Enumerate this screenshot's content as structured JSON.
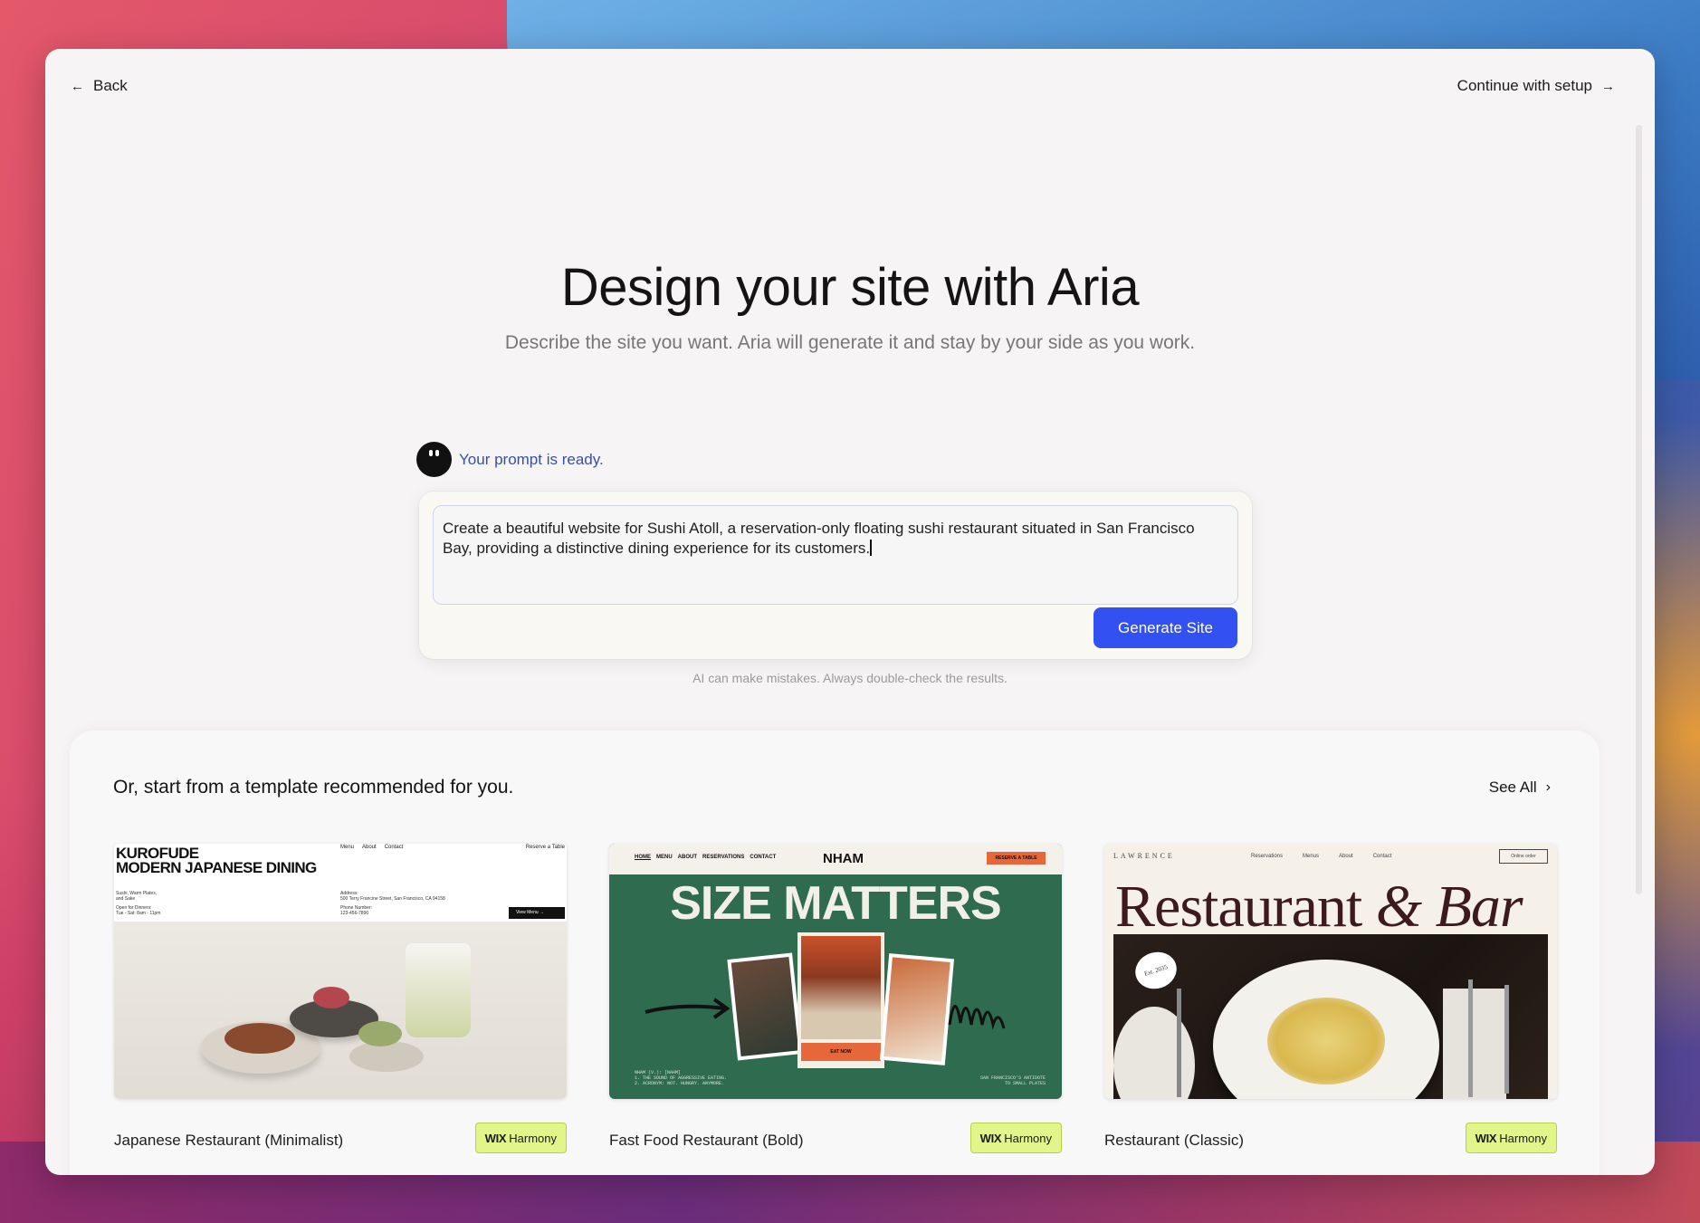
{
  "topbar": {
    "back_label": "Back",
    "continue_label": "Continue with setup"
  },
  "hero": {
    "title": "Design your site with Aria",
    "subtitle": "Describe the site you want. Aria will generate it and stay by your side as you work."
  },
  "prompt": {
    "status_text": "Your prompt is ready.",
    "value": "Create a beautiful website for Sushi Atoll, a reservation-only floating sushi restaurant situated in San Francisco Bay, providing a distinctive dining experience for its customers.",
    "generate_label": "Generate Site",
    "disclaimer": "AI can make mistakes. Always double-check the results."
  },
  "templates": {
    "heading": "Or, start from a template recommended for you.",
    "see_all_label": "See All",
    "items": [
      {
        "name": "Japanese Restaurant (Minimalist)",
        "badge_brand": "WIX",
        "badge_text": "Harmony",
        "thumb": {
          "brand_line1": "KUROFUDE",
          "brand_line2": "MODERN JAPANESE DINING",
          "nav": [
            "Menu",
            "About",
            "Contact"
          ],
          "reserve": "Reserve a Table",
          "info_left_1": "Sushi, Warm Plates,",
          "info_left_2": "and Sake",
          "info_left_3": "Open for Dinners:",
          "info_left_4": "Tue - Sat: 8am - 11pm",
          "address_label": "Address:",
          "address_value": "500 Terry Francine Street, San Francisco, CA 94158",
          "phone_label": "Phone Number:",
          "phone_value": "123-456-7890",
          "menu_button": "View Menu"
        }
      },
      {
        "name": "Fast Food Restaurant (Bold)",
        "badge_brand": "WIX",
        "badge_text": "Harmony",
        "thumb": {
          "nav": [
            "HOME",
            "MENU",
            "ABOUT",
            "RESERVATIONS",
            "CONTACT"
          ],
          "logo": "NHAM",
          "reserve": "RESERVE A TABLE",
          "headline": "SIZE MATTERS",
          "cta": "EAT NOW",
          "foot_left_1": "NHAM (V.): [NAHM]",
          "foot_left_2": "1. THE SOUND OF AGGRESSIVE EATING.",
          "foot_left_3": "2. ACRONYM: NOT. HUNGRY. ANYMORE.",
          "foot_right_1": "SAN FRANCISCO'S ANTIDOTE",
          "foot_right_2": "TO SMALL PLATES"
        }
      },
      {
        "name": "Restaurant (Classic)",
        "badge_brand": "WIX",
        "badge_text": "Harmony",
        "thumb": {
          "logo": "LAWRENCE",
          "nav": [
            "Reservations",
            "Menus",
            "About",
            "Contact"
          ],
          "order": "Online order",
          "headline_1": "Restaurant",
          "headline_2": "& Bar",
          "stamp": "Est. 2035"
        }
      }
    ]
  },
  "colors": {
    "accent": "#3351f0",
    "status_text": "#3b4fa0",
    "badge_bg": "#e2f58a",
    "window_bg": "#f6f4f4"
  },
  "icons": {
    "back": "arrow-left-icon",
    "continue": "arrow-right-icon",
    "see_all": "chevron-right-icon",
    "aria": "aria-avatar-icon"
  }
}
